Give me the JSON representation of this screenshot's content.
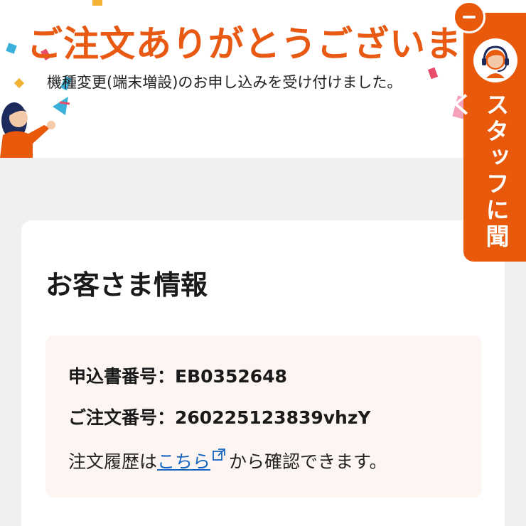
{
  "hero": {
    "title": "ご注文ありがとうございます",
    "subtitle": "機種変更(端末増設)のお申し込みを受け付けました。"
  },
  "customer_info": {
    "heading": "お客さま情報",
    "application_number_label": "申込書番号：",
    "application_number": "EB0352648",
    "order_number_label": "ご注文番号：",
    "order_number": "260225123839vhzY",
    "history_prefix": "注文履歴は",
    "history_link": "こちら",
    "history_suffix": "から確認できます。"
  },
  "staff_tab": {
    "label": "スタッフに聞く",
    "close_icon": "minus-icon",
    "avatar_icon": "headset-operator-icon"
  },
  "colors": {
    "accent": "#e85a14",
    "tab": "#e8590c",
    "link": "#1565c0",
    "info_bg": "#fcf5f2"
  }
}
